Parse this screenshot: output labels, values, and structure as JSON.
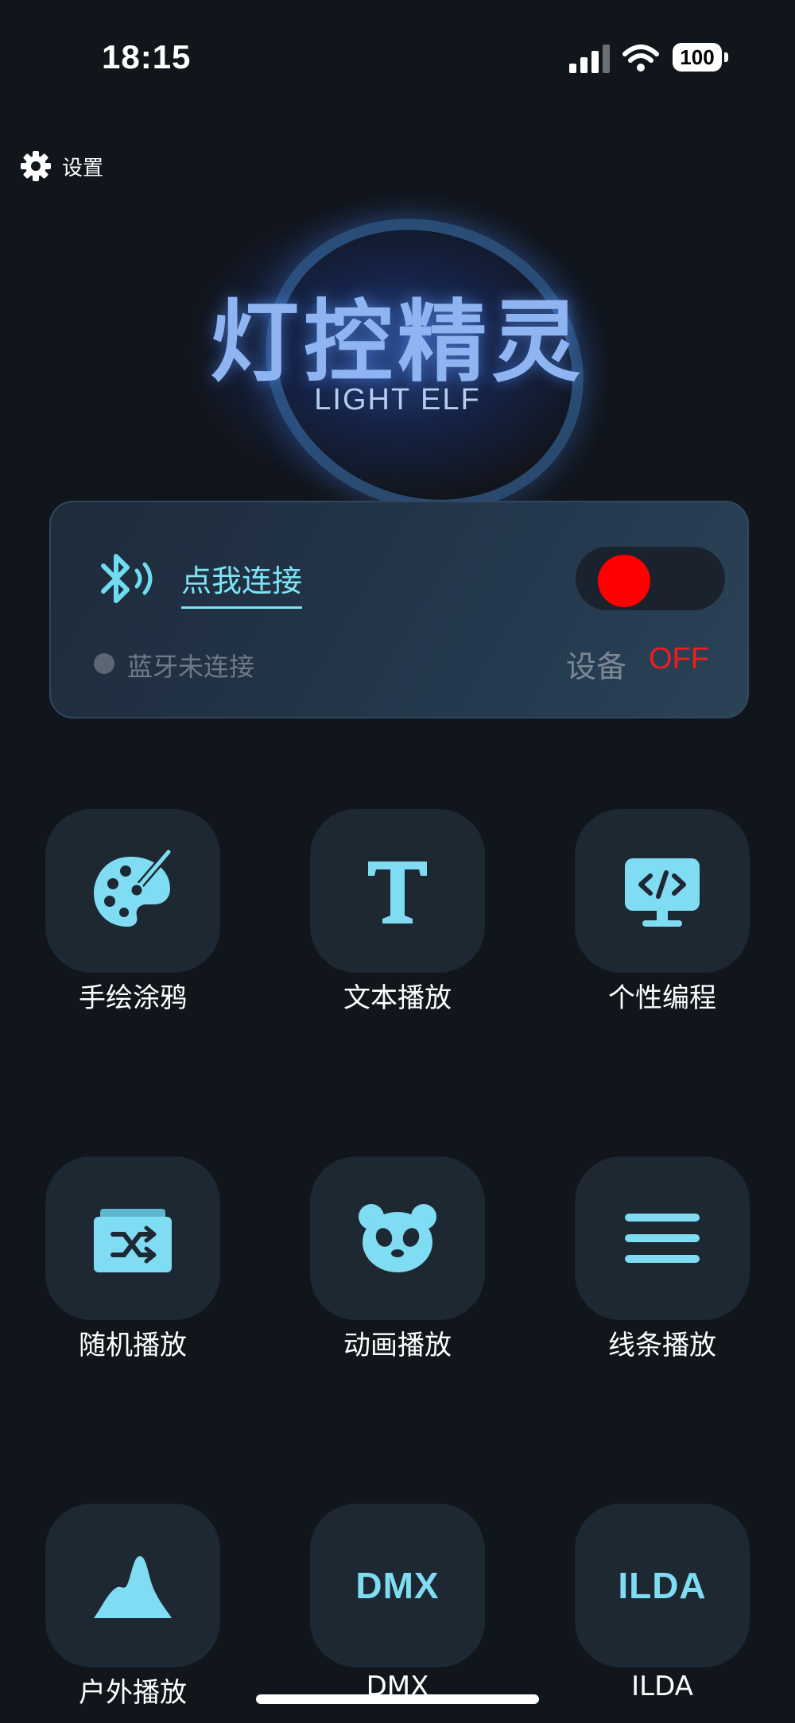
{
  "status_bar": {
    "time": "18:15",
    "battery": "100"
  },
  "settings": {
    "label": "设置",
    "icon": "gear-icon"
  },
  "hero": {
    "title": "灯控精灵",
    "subtitle": "LIGHT ELF"
  },
  "connect_card": {
    "connect_label": "点我连接",
    "bluetooth_status": "蓝牙未连接",
    "device_label": "设备",
    "device_state": "OFF",
    "power_on": false,
    "colors": {
      "accent": "#7fe3f5",
      "off": "#ff0000"
    }
  },
  "features": [
    {
      "label": "手绘涂鸦",
      "icon": "palette-icon"
    },
    {
      "label": "文本播放",
      "icon": "text-icon"
    },
    {
      "label": "个性编程",
      "icon": "code-monitor-icon"
    },
    {
      "label": "随机播放",
      "icon": "shuffle-folder-icon"
    },
    {
      "label": "动画播放",
      "icon": "panda-icon"
    },
    {
      "label": "线条播放",
      "icon": "lines-icon"
    },
    {
      "label": "户外播放",
      "icon": "mountain-icon",
      "icon_text": ""
    },
    {
      "label": "DMX",
      "icon": "dmx-icon",
      "icon_text": "DMX"
    },
    {
      "label": "ILDA",
      "icon": "ilda-icon",
      "icon_text": "ILDA"
    }
  ]
}
